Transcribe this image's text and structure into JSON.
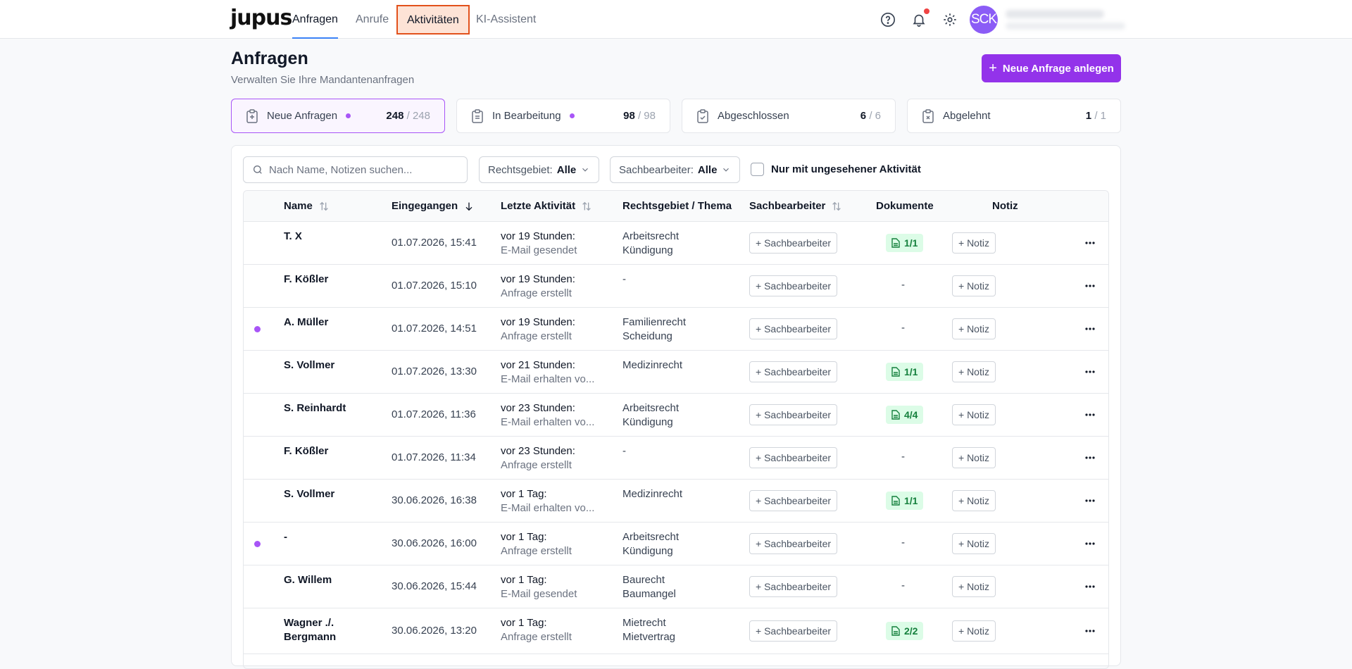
{
  "nav": {
    "logo": "jupus",
    "tabs": [
      "Anfragen",
      "Anrufe",
      "Aktivitäten",
      "KI-Assistent"
    ],
    "avatar_initials": "SCK"
  },
  "header": {
    "title": "Anfragen",
    "subtitle": "Verwalten Sie Ihre Mandantenanfragen",
    "new_button": "Neue Anfrage anlegen"
  },
  "stats": [
    {
      "label": "Neue Anfragen",
      "count": "248",
      "total": "/ 248",
      "dot": true
    },
    {
      "label": "In Bearbeitung",
      "count": "98",
      "total": "/ 98",
      "dot": true
    },
    {
      "label": "Abgeschlossen",
      "count": "6",
      "total": "/ 6",
      "dot": false
    },
    {
      "label": "Abgelehnt",
      "count": "1",
      "total": "/ 1",
      "dot": false
    }
  ],
  "filters": {
    "search_placeholder": "Nach Name, Notizen suchen...",
    "rechtsgebiet_label": "Rechtsgebiet:",
    "rechtsgebiet_value": "Alle",
    "sachbearbeiter_label": "Sachbearbeiter:",
    "sachbearbeiter_value": "Alle",
    "unseen_only": "Nur mit ungesehener Aktivität"
  },
  "table": {
    "columns": [
      "Name",
      "Eingegangen",
      "Letzte Aktivität",
      "Rechtsgebiet / Thema",
      "Sachbearbeiter",
      "Dokumente",
      "Notiz"
    ],
    "sachbearbeiter_btn": "+ Sachbearbeiter",
    "notiz_btn": "+ Notiz",
    "rows": [
      {
        "name": "T. X",
        "date": "01.07.2026, 15:41",
        "act1": "vor 19 Stunden:",
        "act2": "E-Mail gesendet",
        "thema1": "Arbeitsrecht",
        "thema2": "Kündigung",
        "docs": "1/1",
        "unseen": false
      },
      {
        "name": "F. Kößler",
        "date": "01.07.2026, 15:10",
        "act1": "vor 19 Stunden:",
        "act2": "Anfrage erstellt",
        "thema1": "-",
        "thema2": "",
        "docs": "-",
        "unseen": false
      },
      {
        "name": "A. Müller",
        "date": "01.07.2026, 14:51",
        "act1": "vor 19 Stunden:",
        "act2": "Anfrage erstellt",
        "thema1": "Familienrecht",
        "thema2": "Scheidung",
        "docs": "-",
        "unseen": true
      },
      {
        "name": "S. Vollmer",
        "date": "01.07.2026, 13:30",
        "act1": "vor 21 Stunden:",
        "act2": "E-Mail erhalten vo...",
        "thema1": "Medizinrecht",
        "thema2": "",
        "docs": "1/1",
        "unseen": false
      },
      {
        "name": "S. Reinhardt",
        "date": "01.07.2026, 11:36",
        "act1": "vor 23 Stunden:",
        "act2": "E-Mail erhalten vo...",
        "thema1": "Arbeitsrecht",
        "thema2": "Kündigung",
        "docs": "4/4",
        "unseen": false
      },
      {
        "name": "F. Kößler",
        "date": "01.07.2026, 11:34",
        "act1": "vor 23 Stunden:",
        "act2": "Anfrage erstellt",
        "thema1": "-",
        "thema2": "",
        "docs": "-",
        "unseen": false
      },
      {
        "name": "S. Vollmer",
        "date": "30.06.2026, 16:38",
        "act1": "vor 1 Tag:",
        "act2": "E-Mail erhalten vo...",
        "thema1": "Medizinrecht",
        "thema2": "",
        "docs": "1/1",
        "unseen": false
      },
      {
        "name": "-",
        "date": "30.06.2026, 16:00",
        "act1": "vor 1 Tag:",
        "act2": "Anfrage erstellt",
        "thema1": "Arbeitsrecht",
        "thema2": "Kündigung",
        "docs": "-",
        "unseen": true
      },
      {
        "name": "G. Willem",
        "date": "30.06.2026, 15:44",
        "act1": "vor 1 Tag:",
        "act2": "E-Mail gesendet",
        "thema1": "Baurecht",
        "thema2": "Baumangel",
        "docs": "-",
        "unseen": false
      },
      {
        "name": "Wagner ./. Bergmann",
        "date": "30.06.2026, 13:20",
        "act1": "vor 1 Tag:",
        "act2": "Anfrage erstellt",
        "thema1": "Mietrecht",
        "thema2": "Mietvertrag",
        "docs": "2/2",
        "unseen": false
      }
    ]
  },
  "colors": {
    "accent": "#9333ea",
    "unseen_dot": "#a855f7",
    "active_nav_underline": "#3b82f6",
    "highlight_border": "#e2511c",
    "docs_bg": "#dcfce7",
    "docs_text": "#15803d"
  }
}
